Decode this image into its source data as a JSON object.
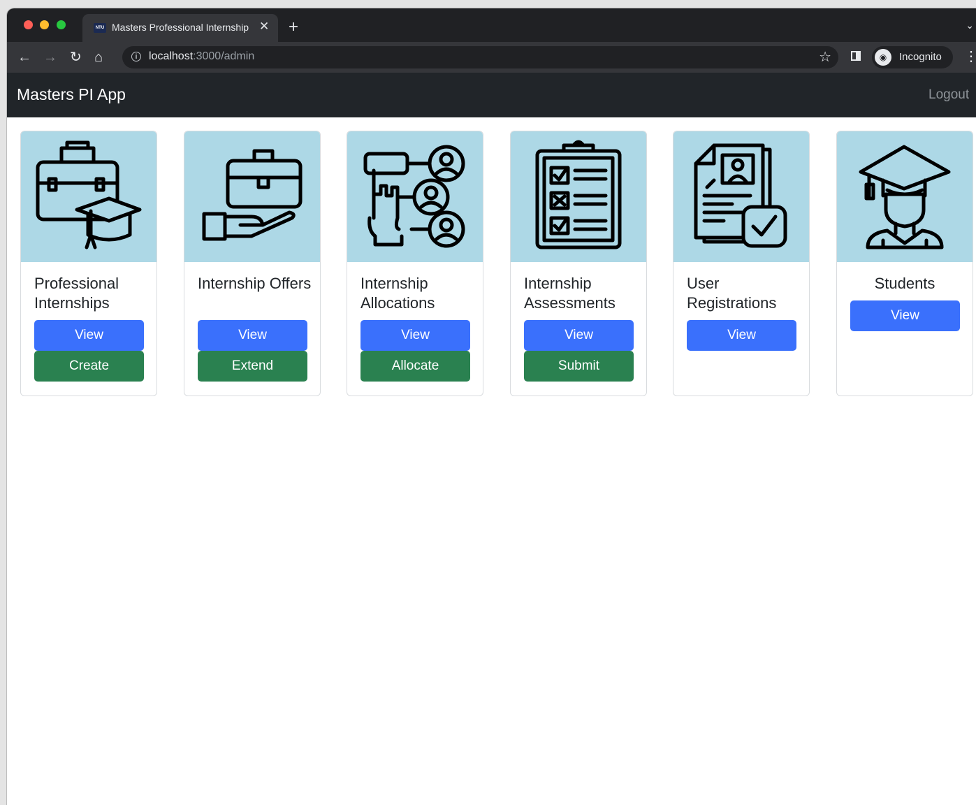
{
  "browser": {
    "tab_title": "Masters Professional Internship",
    "favicon_text": "NTU",
    "close_glyph": "✕",
    "newtab_glyph": "+",
    "url_host": "localhost",
    "url_rest": ":3000/admin",
    "profile_label": "Incognito"
  },
  "app": {
    "brand": "Masters PI App",
    "logout": "Logout"
  },
  "cards": [
    {
      "title": "Professional Internships",
      "buttons": [
        "View",
        "Create"
      ],
      "icon": "briefcase-graduation-cap-icon"
    },
    {
      "title": "Internship Offers",
      "buttons": [
        "View",
        "Extend"
      ],
      "icon": "hand-offering-briefcase-icon"
    },
    {
      "title": "Internship Allocations",
      "buttons": [
        "View",
        "Allocate"
      ],
      "icon": "hand-selecting-person-icon"
    },
    {
      "title": "Internship Assessments",
      "buttons": [
        "View",
        "Submit"
      ],
      "icon": "checklist-clipboard-icon"
    },
    {
      "title": "User Registrations",
      "buttons": [
        "View"
      ],
      "icon": "document-approved-icon"
    },
    {
      "title": "Students",
      "buttons": [
        "View"
      ],
      "icon": "graduate-student-icon"
    }
  ],
  "colors": {
    "primary": "#3a70fc",
    "success": "#2a8150",
    "navbar": "#212529",
    "card_image_bg": "#add8e6"
  }
}
